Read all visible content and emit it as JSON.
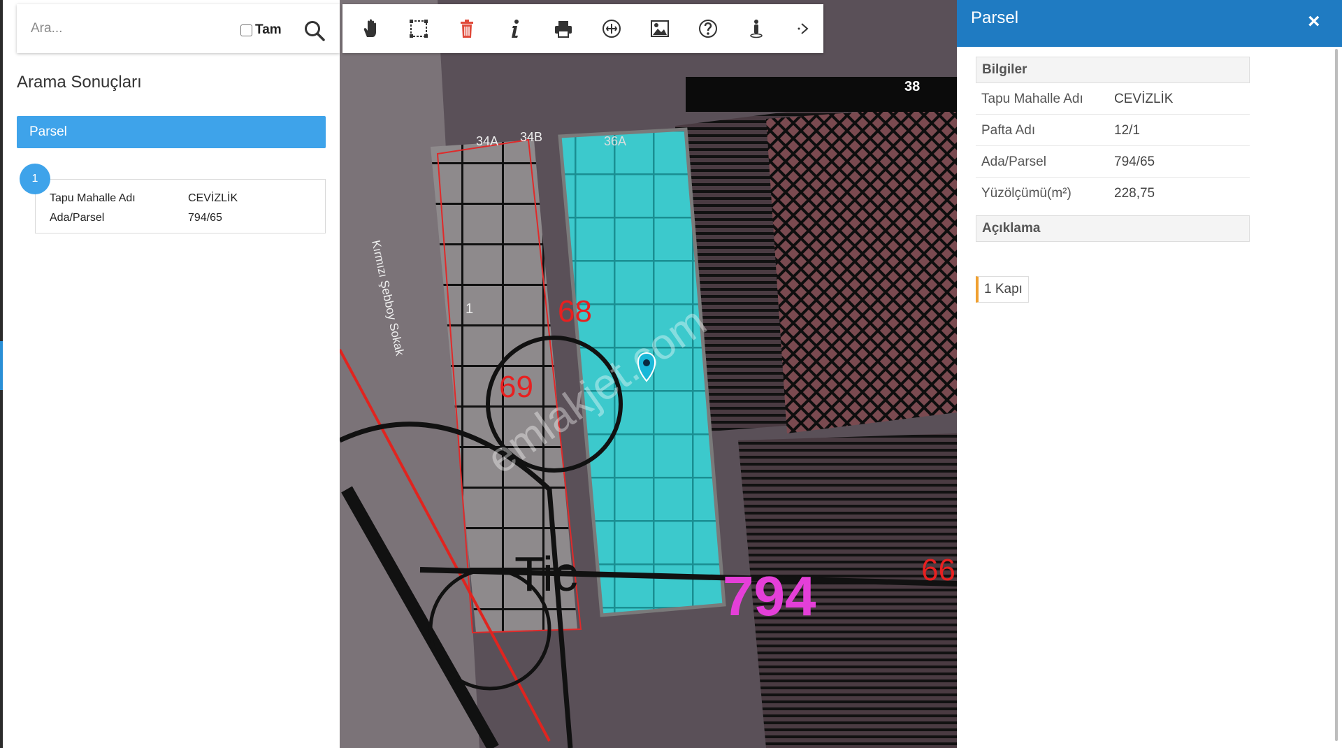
{
  "search": {
    "placeholder": "Ara...",
    "exact_label": "Tam",
    "exact_checked": false
  },
  "results": {
    "title": "Arama Sonuçları",
    "group_label": "Parsel",
    "items": [
      {
        "number": "1",
        "fields": [
          {
            "label": "Tapu Mahalle Adı",
            "value": "CEVİZLİK"
          },
          {
            "label": "Ada/Parsel",
            "value": "794/65"
          }
        ]
      }
    ]
  },
  "toolbar": {
    "tools": [
      "pan-hand-icon",
      "box-select-icon",
      "delete-icon",
      "info-icon",
      "print-icon",
      "measure-icon",
      "map-image-icon",
      "help-icon",
      "street-view-icon",
      "more-icon"
    ]
  },
  "map": {
    "street_label": "Kırmızı Şebboy Sokak",
    "parcel_numbers": [
      "34A",
      "34B",
      "36A",
      "38",
      "68",
      "69",
      "66",
      "1"
    ],
    "block_number": "794",
    "text_fragment": "Tic",
    "watermark": "emlakjet.com",
    "colors": {
      "selected_parcel": "#2fd4d8",
      "block_number": "#e43fd8",
      "parcel_number": "#e82020"
    }
  },
  "panel": {
    "title": "Parsel",
    "close_label": "×",
    "info_section": "Bilgiler",
    "info_rows": [
      {
        "label": "Tapu Mahalle Adı",
        "value": "CEVİZLİK"
      },
      {
        "label": "Pafta Adı",
        "value": "12/1"
      },
      {
        "label": "Ada/Parsel",
        "value": "794/65"
      },
      {
        "label": "Yüzölçümü(m²)",
        "value": "228,75"
      }
    ],
    "desc_section": "Açıklama",
    "desc_tag": "1 Kapı"
  },
  "colors": {
    "header_blue": "#1f7bc2",
    "result_blue": "#3ea3ea",
    "accent_orange": "#f0a030",
    "delete_red": "#e04a3a"
  }
}
